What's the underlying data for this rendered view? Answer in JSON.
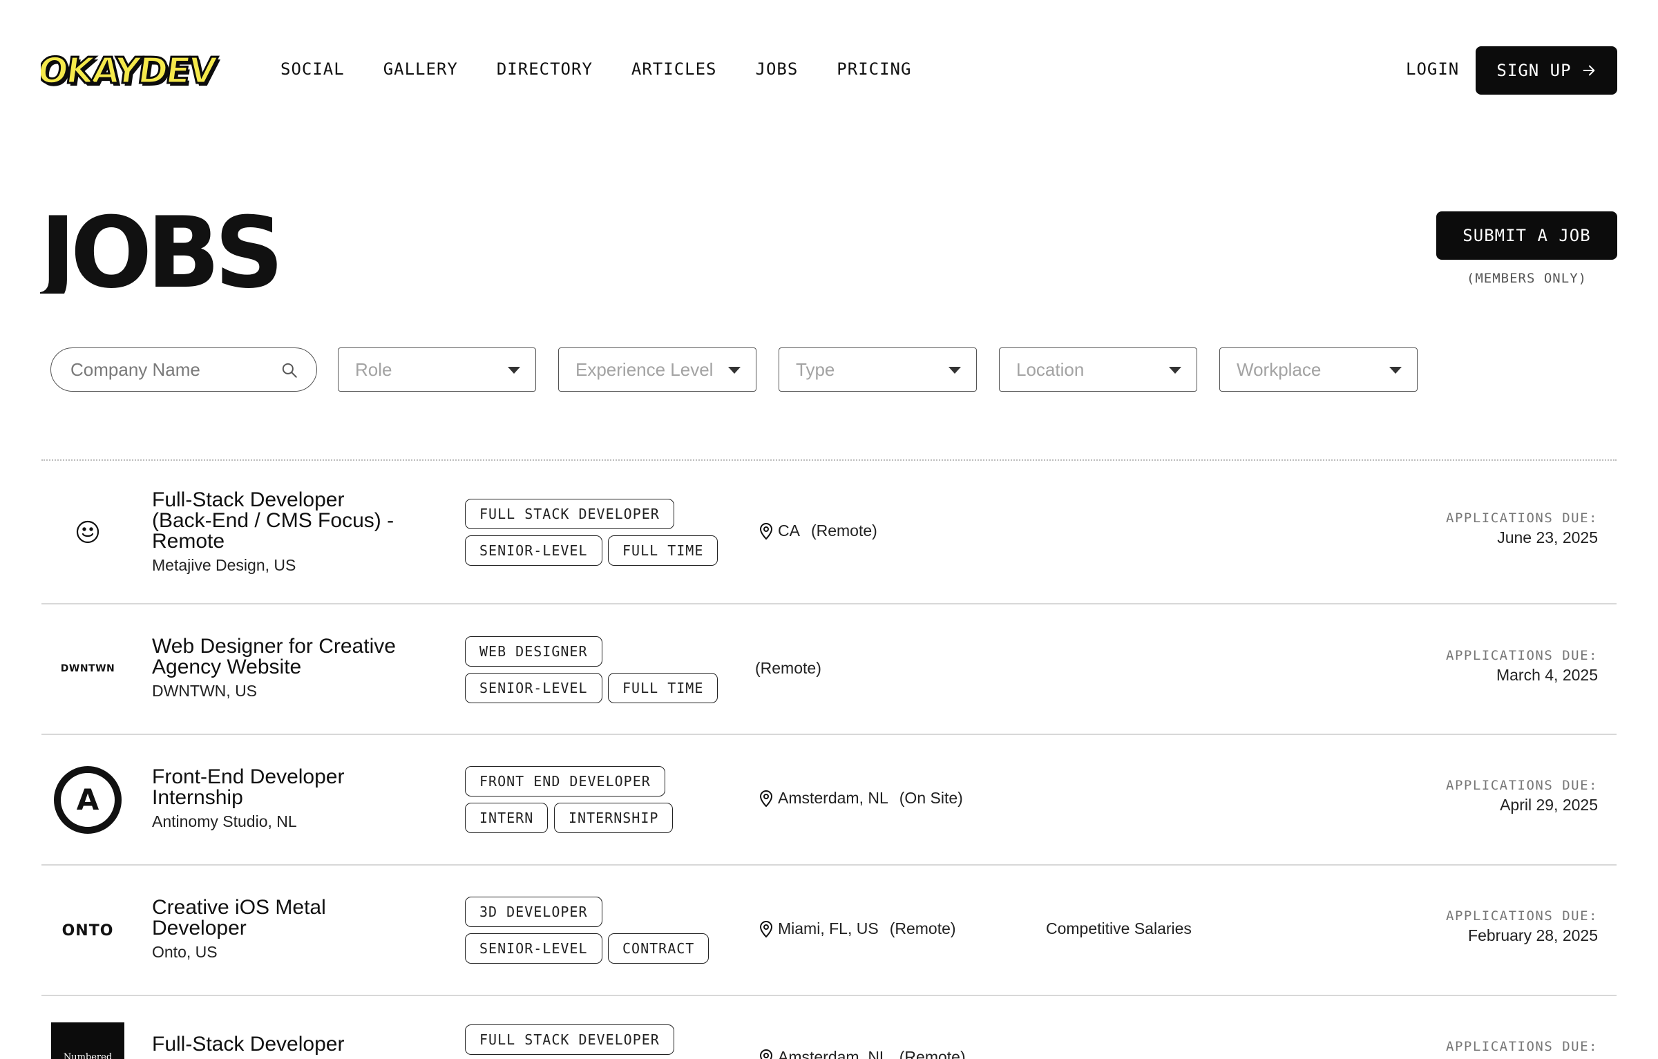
{
  "brand": {
    "logo_text": "OKAYDEV",
    "accent_color": "#F5E94B",
    "dark_color": "#0C0C0C"
  },
  "nav": {
    "items": [
      {
        "label": "SOCIAL"
      },
      {
        "label": "GALLERY"
      },
      {
        "label": "DIRECTORY"
      },
      {
        "label": "ARTICLES"
      },
      {
        "label": "JOBS"
      },
      {
        "label": "PRICING"
      }
    ],
    "login_label": "LOGIN",
    "signup_label": "SIGN UP"
  },
  "page": {
    "title": "JOBS",
    "submit_label": "SUBMIT A JOB",
    "members_note": "(MEMBERS ONLY)"
  },
  "filters": {
    "company_placeholder": "Company Name",
    "role": "Role",
    "experience": "Experience Level",
    "type": "Type",
    "location": "Location",
    "workplace": "Workplace"
  },
  "jobs": [
    {
      "title_lines": [
        "Full-Stack Developer",
        "(Back-End / CMS Focus) -",
        "Remote"
      ],
      "company": "Metajive Design, US",
      "logo": "smiley-icon",
      "tags": [
        "FULL STACK DEVELOPER",
        "SENIOR-LEVEL",
        "FULL TIME"
      ],
      "location": "CA",
      "workplace": "(Remote)",
      "salary": "",
      "due_label": "APPLICATIONS DUE:",
      "due_date": "June 23, 2025"
    },
    {
      "title_lines": [
        "Web Designer for Creative",
        "Agency Website"
      ],
      "company": "DWNTWN, US",
      "logo": "DWNTWN",
      "tags": [
        "WEB DESIGNER",
        "SENIOR-LEVEL",
        "FULL TIME"
      ],
      "location": "",
      "workplace": "(Remote)",
      "salary": "",
      "due_label": "APPLICATIONS DUE:",
      "due_date": "March 4, 2025"
    },
    {
      "title_lines": [
        "Front-End Developer",
        "Internship"
      ],
      "company": "Antinomy Studio, NL",
      "logo": "A",
      "tags": [
        "FRONT END DEVELOPER",
        "INTERN",
        "INTERNSHIP"
      ],
      "location": "Amsterdam, NL",
      "workplace": "(On Site)",
      "salary": "",
      "due_label": "APPLICATIONS DUE:",
      "due_date": "April 29, 2025"
    },
    {
      "title_lines": [
        "Creative iOS Metal",
        "Developer"
      ],
      "company": "Onto, US",
      "logo": "ONTO",
      "tags": [
        "3D DEVELOPER",
        "SENIOR-LEVEL",
        "CONTRACT"
      ],
      "location": "Miami, FL, US",
      "workplace": "(Remote)",
      "salary": "Competitive Salaries",
      "due_label": "APPLICATIONS DUE:",
      "due_date": "February 28, 2025"
    },
    {
      "title_lines": [
        "Full-Stack Developer"
      ],
      "company": "",
      "logo": "Numbered",
      "tags": [
        "FULL STACK DEVELOPER"
      ],
      "location": "Amsterdam, NL",
      "workplace": "(Remote)",
      "salary": "",
      "due_label": "APPLICATIONS DUE:",
      "due_date": ""
    }
  ]
}
